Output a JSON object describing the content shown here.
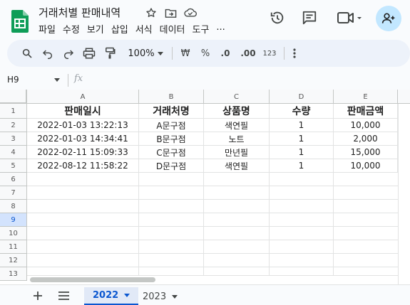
{
  "document": {
    "title": "거래처별 판매내역"
  },
  "menu": {
    "items": [
      "파일",
      "수정",
      "보기",
      "삽입",
      "서식",
      "데이터",
      "도구",
      "..."
    ]
  },
  "toolbar": {
    "zoom": "100%",
    "currency": "₩",
    "percent": "%",
    "decrease_decimals": ".0",
    "increase_decimals": ".00",
    "number_format": "123"
  },
  "formula_bar": {
    "name_box": "H9",
    "fx": "fx"
  },
  "sheet": {
    "columns": [
      "A",
      "B",
      "C",
      "D",
      "E"
    ],
    "row_numbers": [
      "1",
      "2",
      "3",
      "4",
      "5",
      "6",
      "7",
      "8",
      "9",
      "10",
      "11",
      "12",
      "13"
    ],
    "selected_row": "9",
    "header_row": [
      "판매일시",
      "거래처명",
      "상품명",
      "수량",
      "판매금액"
    ],
    "rows": [
      [
        "2022-01-03 13:22:13",
        "A문구점",
        "색연필",
        "1",
        "10,000"
      ],
      [
        "2022-01-03 14:34:41",
        "B문구점",
        "노트",
        "1",
        "2,000"
      ],
      [
        "2022-02-11 15:09:33",
        "C문구점",
        "만년필",
        "1",
        "15,000"
      ],
      [
        "2022-08-12 11:58:22",
        "D문구점",
        "색연필",
        "1",
        "10,000"
      ]
    ]
  },
  "tabs": {
    "sheets": [
      "2022",
      "2023"
    ],
    "active": "2022"
  },
  "colors": {
    "accent": "#0b57d0",
    "logo_green": "#0f9d58",
    "share_bg": "#c2e7ff"
  }
}
